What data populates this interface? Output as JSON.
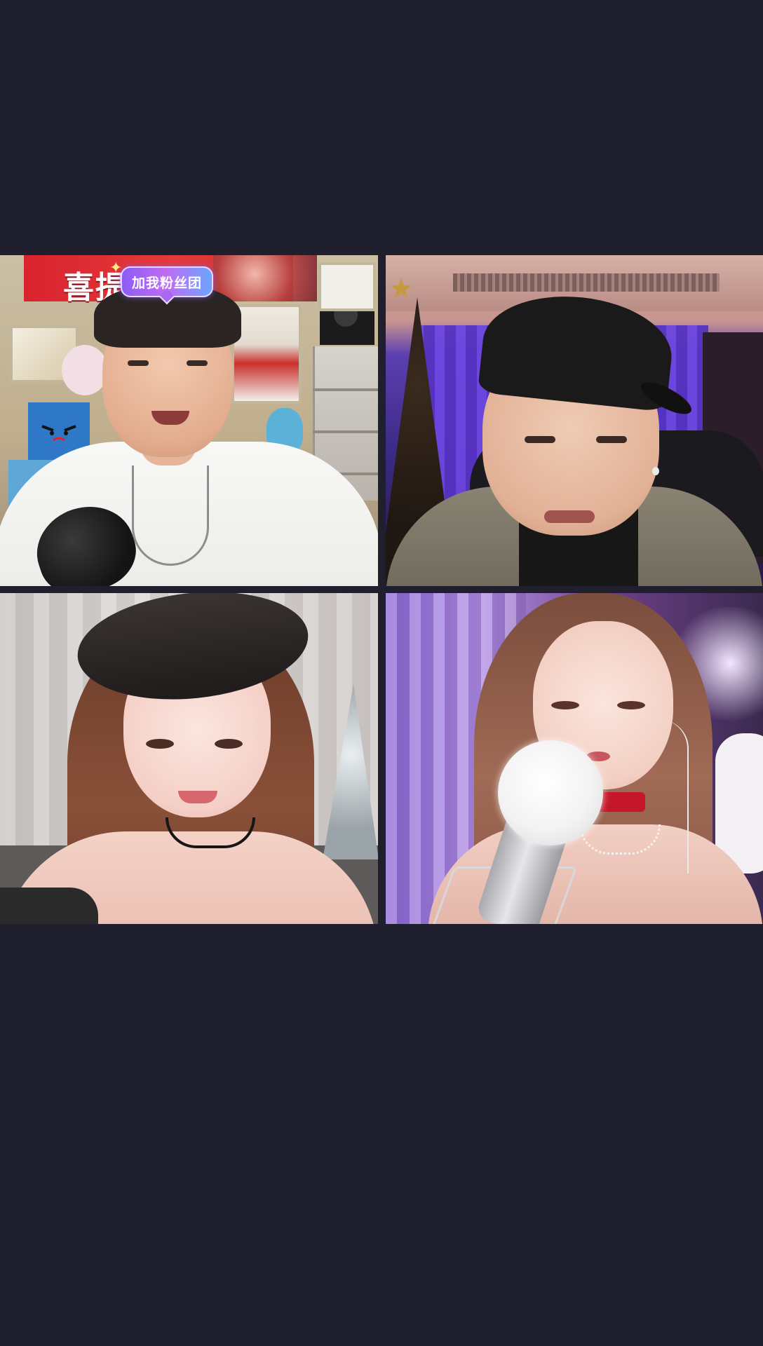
{
  "screen": {
    "background_color": "#1f1f2d"
  },
  "video_grid": {
    "tiles": [
      {
        "position": "top-left",
        "banner_text": "喜提",
        "badge_label": "加我粉丝团",
        "badge_icon": "star-icon",
        "badge_colors": [
          "#8d5cf6",
          "#c06cf2",
          "#6aa6ff"
        ]
      },
      {
        "position": "top-right"
      },
      {
        "position": "bottom-left"
      },
      {
        "position": "bottom-right"
      }
    ],
    "divider_color": "#1f1f2d"
  }
}
